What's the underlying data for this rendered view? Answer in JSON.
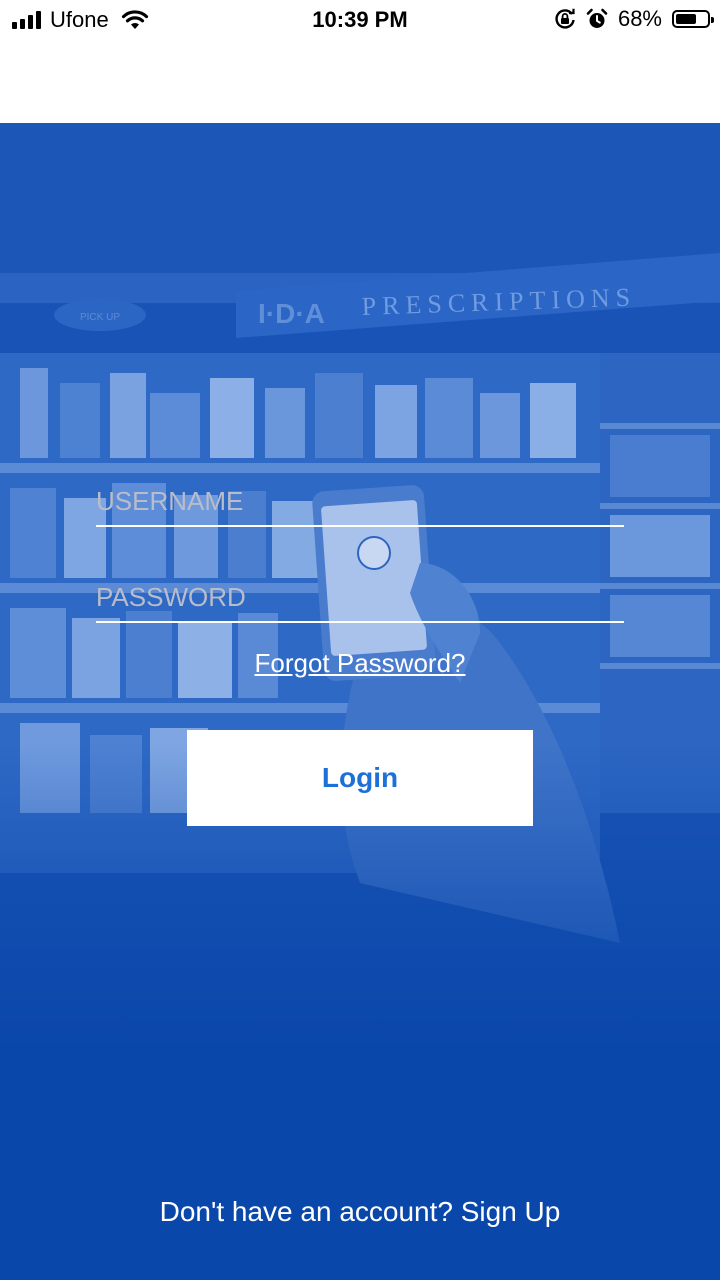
{
  "status_bar": {
    "carrier": "Ufone",
    "time": "10:39 PM",
    "battery_percent": "68%",
    "battery_level": 0.68,
    "icons": [
      "signal-icon",
      "wifi-icon",
      "orientation-lock-icon",
      "alarm-icon",
      "battery-icon"
    ]
  },
  "background": {
    "scene": "pharmacy-aisle-photo",
    "sign_text": "I·D·A PRESCRIPTIONS",
    "overlay_color": "#0a47aa"
  },
  "login_form": {
    "username_placeholder": "USERNAME",
    "password_placeholder": "PASSWORD",
    "forgot_password": "Forgot Password?",
    "login_label": "Login",
    "signup_prompt": "Don't have an account? Sign Up"
  },
  "colors": {
    "primary": "#0a47aa",
    "button_text": "#1d70d8",
    "placeholder": "#b9bcc9"
  }
}
